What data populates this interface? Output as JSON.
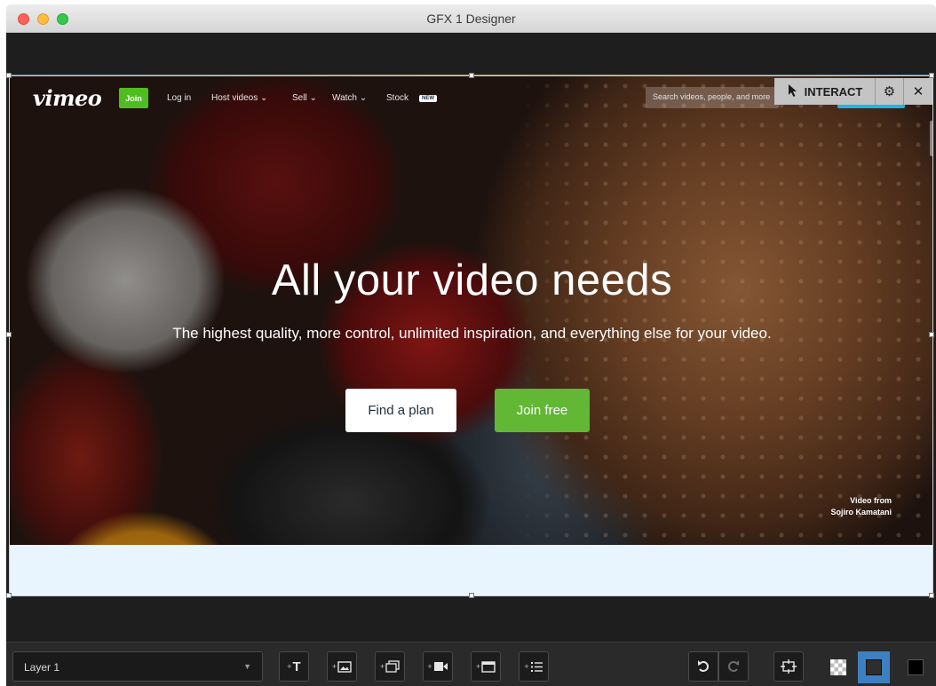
{
  "window": {
    "title": "GFX 1 Designer"
  },
  "webpage": {
    "logo": "vimeo",
    "nav": {
      "join": "Join",
      "login": "Log in",
      "host_videos": "Host videos ⌄",
      "sell": "Sell ⌄",
      "watch": "Watch ⌄",
      "stock": "Stock",
      "stock_badge": "NEW",
      "search_placeholder": "Search videos, people, and more"
    },
    "hero": {
      "title": "All your video needs",
      "subtitle": "The highest quality, more control, unlimited inspiration, and everything else for your video.",
      "find_plan": "Find a plan",
      "join_free": "Join free",
      "credit_line1": "Video from",
      "credit_line2": "Sojiro Kamatani"
    }
  },
  "interact_bar": {
    "label": "INTERACT",
    "icons": [
      "cursor-icon",
      "gear-icon",
      "close-icon"
    ]
  },
  "toolbar": {
    "layer": "Layer 1",
    "buttons": [
      "add-text",
      "add-image",
      "add-slideshow",
      "add-video",
      "add-browser",
      "add-list",
      "undo",
      "redo",
      "fit-to-screen"
    ],
    "view_modes": [
      "checkerboard",
      "dark",
      "black"
    ],
    "selected_view": "dark"
  },
  "colors": {
    "vimeo_green": "#62b735",
    "vimeo_blue": "#1ab7ea",
    "selected_view": "#3d7fc1"
  }
}
